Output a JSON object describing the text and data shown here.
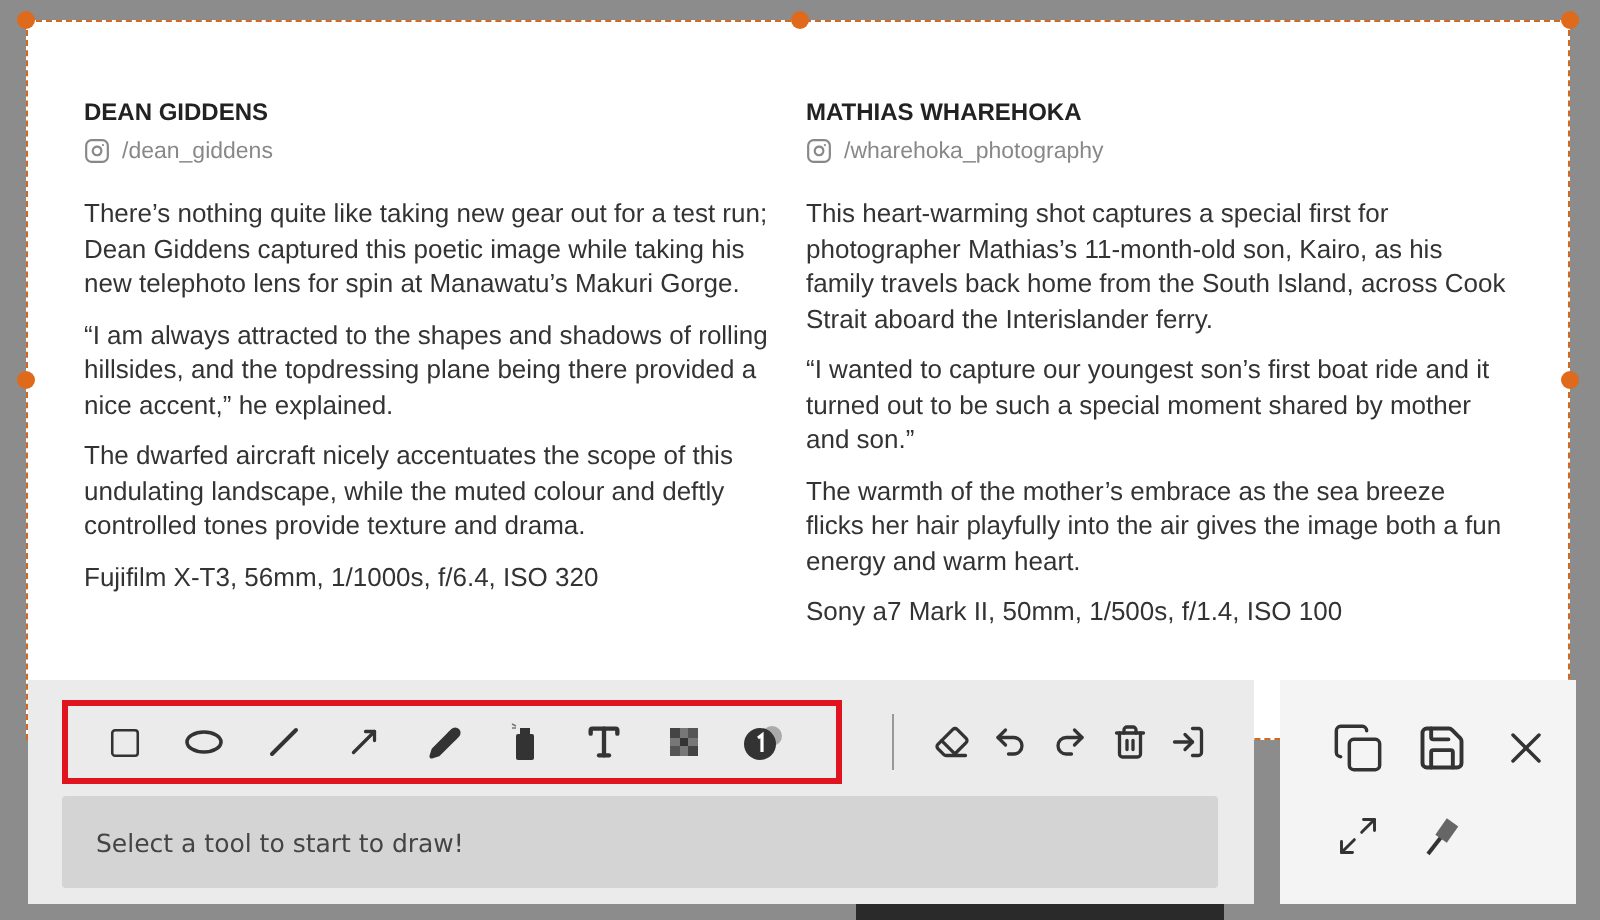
{
  "article": {
    "columns": [
      {
        "name": "DEAN GIDDENS",
        "handle": "/dean_giddens",
        "paragraphs": [
          "There’s nothing quite like taking new gear out for a test run; Dean Giddens captured this poetic image while taking his new telephoto lens for spin at Manawatu’s Makuri Gorge.",
          "“I am always attracted to the shapes and shadows of rolling hillsides, and the topdressing plane being there provided a nice accent,” he explained.",
          "The dwarfed aircraft nicely accentuates the scope of this undulating landscape, while the muted colour and deftly controlled tones provide texture and drama.",
          "Fujifilm X-T3, 56mm, 1/1000s, f/6.4, ISO 320"
        ]
      },
      {
        "name": "MATHIAS WHAREHOKA",
        "handle": "/wharehoka_photography",
        "paragraphs": [
          "This heart-warming shot captures a special first for photographer Mathias’s 11-month-old son, Kairo, as his family travels back home from the South Island, across Cook Strait aboard the Interislander ferry.",
          "“I wanted to capture our youngest son’s first boat ride and it turned out to be such a special moment shared by mother and son.”",
          "The warmth of the mother’s embrace as the sea breeze flicks her hair playfully into the air gives the image both a fun energy and warm heart.",
          "Sony a7 Mark II, 50mm, 1/500s, f/1.4, ISO 100"
        ]
      }
    ]
  },
  "toolbar": {
    "draw_tools_highlighted": true,
    "status": "Select a tool to start to draw!"
  }
}
